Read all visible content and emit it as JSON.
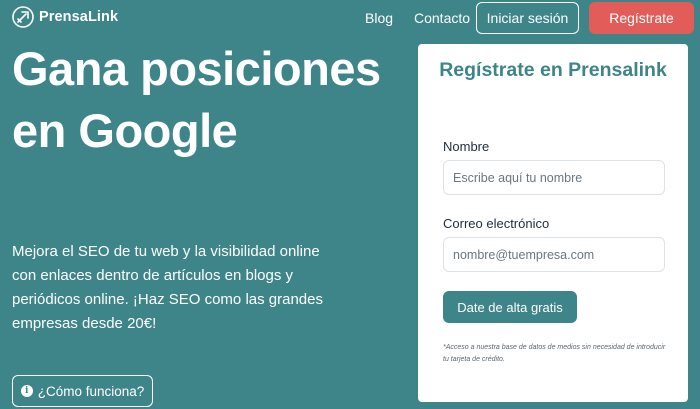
{
  "nav": {
    "logo_text": "PrensaLink",
    "blog": "Blog",
    "contact": "Contacto",
    "login": "Iniciar sesión",
    "register": "Regístrate"
  },
  "hero": {
    "title": "Gana posiciones en Google",
    "description": "Mejora el SEO de tu web y la visibilidad online con enlaces dentro de artículos en blogs y periódicos online. ¡Haz SEO como las grandes empresas desde 20€!",
    "how_button": "¿Cómo funciona?"
  },
  "form": {
    "title": "Regístrate en Prensalink",
    "name_label": "Nombre",
    "name_placeholder": "Escribe aquí tu nombre",
    "email_label": "Correo electrónico",
    "email_placeholder": "nombre@tuempresa.com",
    "submit": "Date de alta gratis",
    "disclaimer": "*Acceso a nuestra base de datos de medios sin necesidad de introducir tu tarjeta de crédito."
  },
  "colors": {
    "background": "#3d8589",
    "accent": "#e25d5a",
    "card": "#ffffff"
  },
  "icons": {
    "logo": "rocket-circle-icon",
    "how": "info-circle-icon"
  }
}
